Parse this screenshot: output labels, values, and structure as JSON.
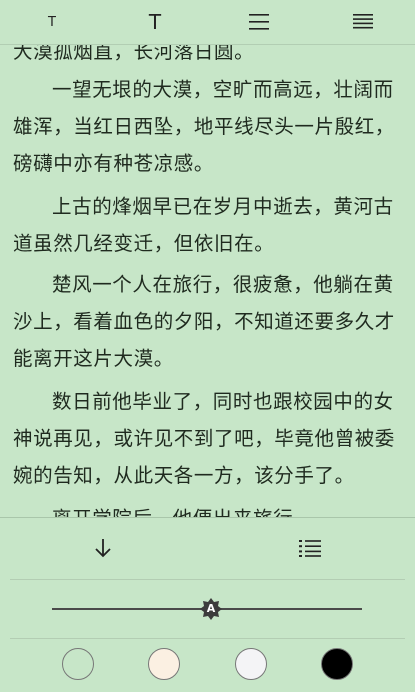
{
  "toolbar": {
    "items": [
      {
        "name": "font-decrease-icon",
        "glyph": "T",
        "size": 13
      },
      {
        "name": "font-increase-icon",
        "glyph": "T",
        "size": 20
      },
      {
        "name": "line-spacing-wide-icon"
      },
      {
        "name": "line-spacing-narrow-icon"
      }
    ]
  },
  "reader": {
    "paragraphs": [
      "大漠孤烟直，长河落日圆。",
      "一望无垠的大漠，空旷而高远，壮阔而雄浑，当红日西坠，地平线尽头一片殷红，磅礴中亦有种苍凉感。",
      "上古的烽烟早已在岁月中逝去，黄河古道虽然几经变迁，但依旧在。",
      "楚风一个人在旅行，很疲惫，他躺在黄沙上，看着血色的夕阳，不知道还要多久才能离开这片大漠。",
      "数日前他毕业了，同时也跟校园中的女神说再见，或许见不到了吧，毕竟他曾被委婉的告知，从此天各一方，该分手了。",
      "离开学院后，他便出来旅行"
    ]
  },
  "panel": {
    "download_icon": "arrow-down-icon",
    "toc_icon": "list-icon",
    "brightness": {
      "value": 0.5,
      "thumb_label": "A"
    },
    "themes": [
      {
        "name": "theme-green",
        "color": "#c7e6c8",
        "selected": true
      },
      {
        "name": "theme-cream",
        "color": "#fbf0e2",
        "selected": false
      },
      {
        "name": "theme-white",
        "color": "#f4f4f6",
        "selected": false
      },
      {
        "name": "theme-black",
        "color": "#000000",
        "selected": false
      }
    ]
  }
}
